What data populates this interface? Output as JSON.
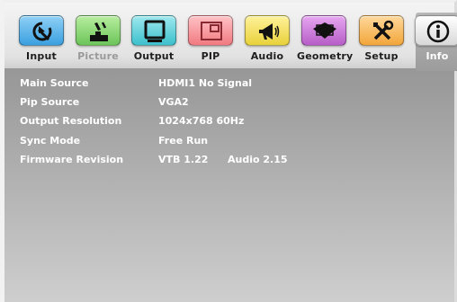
{
  "menu": {
    "tabs": [
      {
        "label": "Input",
        "icon": "input-arrow-icon",
        "color": "#3aa0e0",
        "state": "normal"
      },
      {
        "label": "Picture",
        "icon": "picture-paint-icon",
        "color": "#6cc45a",
        "state": "dim"
      },
      {
        "label": "Output",
        "icon": "monitor-icon",
        "color": "#3cc0cc",
        "state": "normal"
      },
      {
        "label": "PIP",
        "icon": "pip-window-icon",
        "color": "#f07a80",
        "state": "normal"
      },
      {
        "label": "Audio",
        "icon": "speaker-icon",
        "color": "#e8d23a",
        "state": "normal"
      },
      {
        "label": "Geometry",
        "icon": "geometry-shape-icon",
        "color": "#b75ec8",
        "state": "normal"
      },
      {
        "label": "Setup",
        "icon": "tools-icon",
        "color": "#f2a63a",
        "state": "normal"
      },
      {
        "label": "Info",
        "icon": "info-icon",
        "color": "#f0f0f0",
        "state": "active"
      }
    ]
  },
  "info": {
    "rows": [
      {
        "key": "Main Source",
        "value": "HDMI1 No Signal",
        "value2": ""
      },
      {
        "key": "Pip Source",
        "value": "VGA2",
        "value2": ""
      },
      {
        "key": "Output Resolution",
        "value": "1024x768 60Hz",
        "value2": ""
      },
      {
        "key": "Sync Mode",
        "value": "Free Run",
        "value2": ""
      },
      {
        "key": "Firmware Revision",
        "value": "VTB 1.22",
        "value2": "Audio 2.15"
      }
    ]
  }
}
